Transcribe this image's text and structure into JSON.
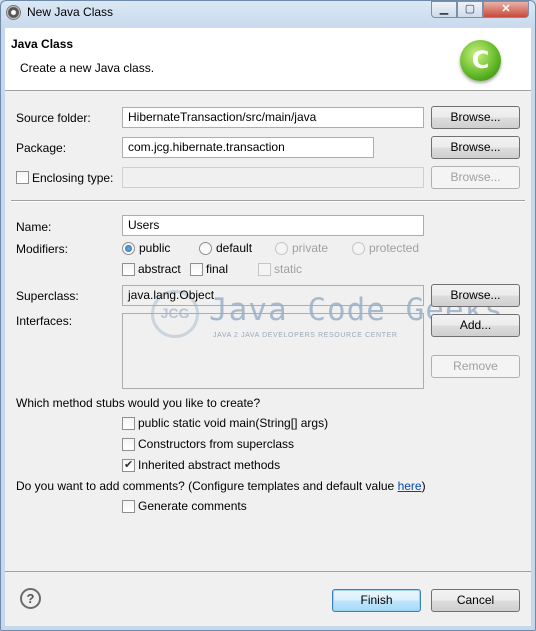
{
  "window": {
    "title": "New Java Class"
  },
  "header": {
    "title": "Java Class",
    "description": "Create a new Java class.",
    "logo_letter": "C"
  },
  "source_folder": {
    "label": "Source folder:",
    "value": "HibernateTransaction/src/main/java",
    "button": "Browse..."
  },
  "package": {
    "label": "Package:",
    "value": "com.jcg.hibernate.transaction",
    "button": "Browse..."
  },
  "enclosing_type": {
    "label": "Enclosing type:",
    "value": "",
    "button": "Browse...",
    "checked": false
  },
  "name": {
    "label": "Name:",
    "value": "Users"
  },
  "modifiers": {
    "label": "Modifiers:",
    "access": [
      {
        "label": "public",
        "selected": true,
        "enabled": true
      },
      {
        "label": "default",
        "selected": false,
        "enabled": true
      },
      {
        "label": "private",
        "selected": false,
        "enabled": false
      },
      {
        "label": "protected",
        "selected": false,
        "enabled": false
      }
    ],
    "flags": [
      {
        "label": "abstract",
        "checked": false,
        "enabled": true
      },
      {
        "label": "final",
        "checked": false,
        "enabled": true
      },
      {
        "label": "static",
        "checked": false,
        "enabled": false
      }
    ]
  },
  "superclass": {
    "label": "Superclass:",
    "value": "java.lang.Object",
    "button": "Browse..."
  },
  "interfaces": {
    "label": "Interfaces:",
    "add_button": "Add...",
    "remove_button": "Remove",
    "items": []
  },
  "watermark": {
    "badge": "JCG",
    "title": "Java Code Geeks",
    "subtitle": "JAVA 2 JAVA DEVELOPERS RESOURCE CENTER"
  },
  "method_stubs": {
    "question": "Which method stubs would you like to create?",
    "options": [
      {
        "label": "public static void main(String[] args)",
        "checked": false
      },
      {
        "label": "Constructors from superclass",
        "checked": false
      },
      {
        "label": "Inherited abstract methods",
        "checked": true
      }
    ]
  },
  "comments": {
    "question": "Do you want to add comments? (Configure templates and default value ",
    "link": "here",
    "question_end": ")",
    "option": {
      "label": "Generate comments",
      "checked": false
    }
  },
  "footer": {
    "help": "?",
    "finish": "Finish",
    "cancel": "Cancel"
  }
}
